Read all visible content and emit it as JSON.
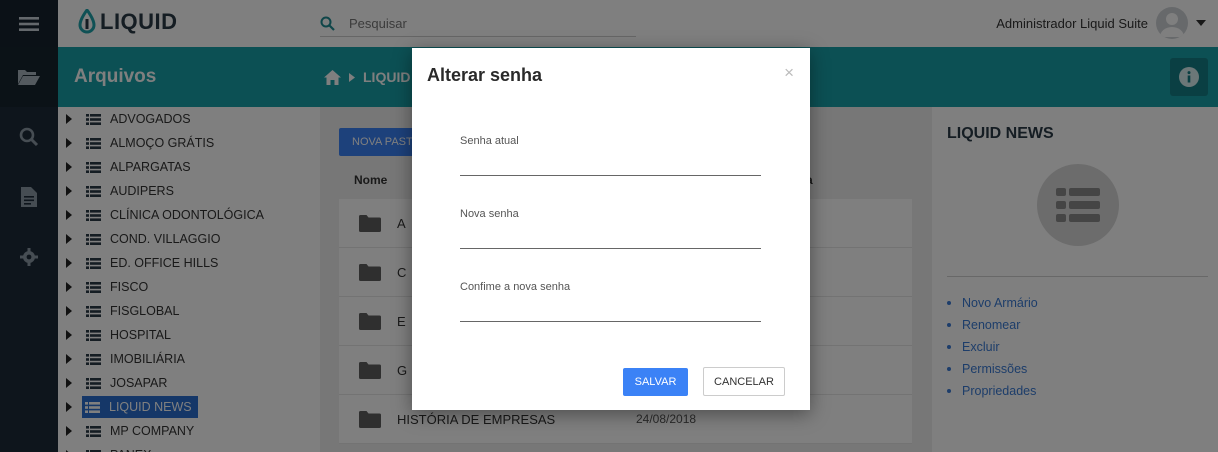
{
  "app": {
    "logo_text": "LIQUID"
  },
  "search": {
    "placeholder": "Pesquisar"
  },
  "user": {
    "name": "Administrador Liquid Suite"
  },
  "header": {
    "title": "Arquivos",
    "breadcrumb": "LIQUID"
  },
  "tree": {
    "items": [
      {
        "label": "ADVOGADOS"
      },
      {
        "label": "ALMOÇO GRÁTIS"
      },
      {
        "label": "ALPARGATAS"
      },
      {
        "label": "AUDIPERS"
      },
      {
        "label": "CLÍNICA ODONTOLÓGICA"
      },
      {
        "label": "COND. VILLAGGIO"
      },
      {
        "label": "ED. OFFICE HILLS"
      },
      {
        "label": "FISCO"
      },
      {
        "label": "FISGLOBAL"
      },
      {
        "label": "HOSPITAL"
      },
      {
        "label": "IMOBILIÁRIA"
      },
      {
        "label": "JOSAPAR"
      },
      {
        "label": "LIQUID NEWS",
        "selected": true
      },
      {
        "label": "MP COMPANY"
      },
      {
        "label": "PANEX"
      }
    ]
  },
  "content": {
    "new_folder_label": "NOVA PASTA",
    "columns": {
      "name": "Nome",
      "date": "a"
    },
    "rows": [
      {
        "name": "A",
        "date": ""
      },
      {
        "name": "C",
        "date": ""
      },
      {
        "name": "E",
        "date": ""
      },
      {
        "name": "G",
        "date": ""
      },
      {
        "name": "HISTÓRIA DE EMPRESAS",
        "date": "24/08/2018"
      }
    ]
  },
  "news": {
    "title": "LIQUID NEWS",
    "links": [
      "Novo Armário",
      "Renomear",
      "Excluir",
      "Permissões",
      "Propriedades"
    ]
  },
  "modal": {
    "title": "Alterar senha",
    "close": "×",
    "fields": [
      {
        "label": "Senha atual",
        "value": ""
      },
      {
        "label": "Nova senha",
        "value": ""
      },
      {
        "label": "Confime a nova senha",
        "value": ""
      }
    ],
    "save_label": "SALVAR",
    "cancel_label": "CANCELAR"
  },
  "colors": {
    "teal": "#19a1a8",
    "rail": "#1c2b39",
    "primary": "#3b82f6",
    "link": "#3a7bd5"
  }
}
